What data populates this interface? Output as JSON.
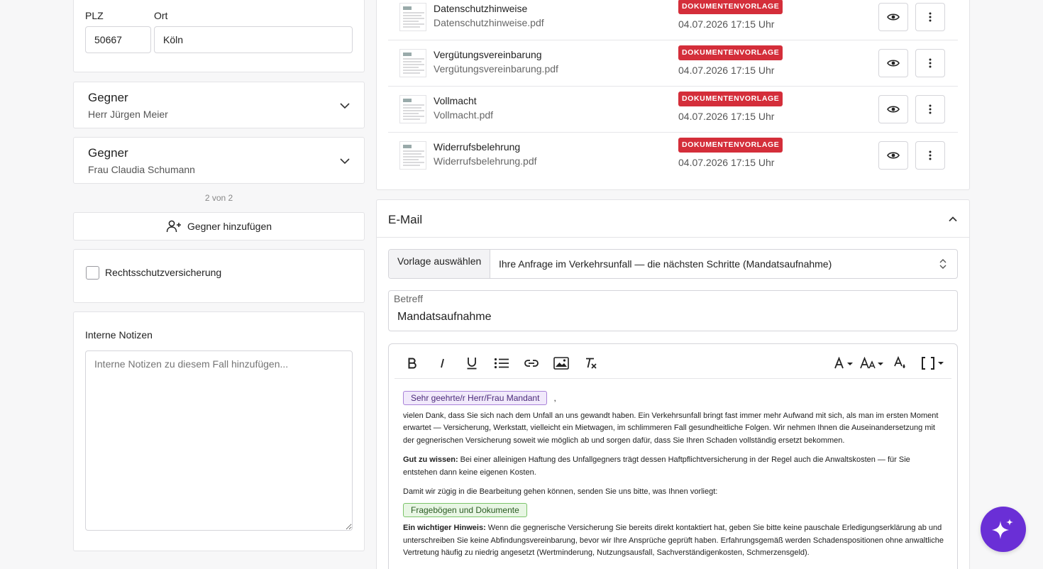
{
  "address": {
    "plz_label": "PLZ",
    "plz_value": "50667",
    "ort_label": "Ort",
    "ort_value": "Köln"
  },
  "opponents": [
    {
      "title": "Gegner",
      "name": "Herr Jürgen Meier"
    },
    {
      "title": "Gegner",
      "name": "Frau Claudia Schumann"
    }
  ],
  "pagination": "2 von 2",
  "add_opponent_label": "Gegner hinzufügen",
  "insurance_label": "Rechtsschutzversicherung",
  "notes": {
    "label": "Interne Notizen",
    "placeholder": "Interne Notizen zu diesem Fall hinzufügen..."
  },
  "documents": [
    {
      "name": "Datenschutzhinweise",
      "file": "Datenschutzhinweise.pdf",
      "badge": "DOKUMENTENVORLAGE",
      "date": "04.07.2026 17:15 Uhr"
    },
    {
      "name": "Vergütungsvereinbarung",
      "file": "Vergütungsvereinbarung.pdf",
      "badge": "DOKUMENTENVORLAGE",
      "date": "04.07.2026 17:15 Uhr"
    },
    {
      "name": "Vollmacht",
      "file": "Vollmacht.pdf",
      "badge": "DOKUMENTENVORLAGE",
      "date": "04.07.2026 17:15 Uhr"
    },
    {
      "name": "Widerrufsbelehrung",
      "file": "Widerrufsbelehrung.pdf",
      "badge": "DOKUMENTENVORLAGE",
      "date": "04.07.2026 17:15 Uhr"
    }
  ],
  "email": {
    "section_title": "E-Mail",
    "template_label": "Vorlage auswählen",
    "template_value": "Ihre Anfrage im Verkehrsunfall — die nächsten Schritte (Mandatsaufnahme)",
    "subject_label": "Betreff",
    "subject_value": "Mandatsaufnahme",
    "body": {
      "salutation_chip": "Sehr geehrte/r Herr/Frau Mandant",
      "salutation_suffix": ",",
      "p1": "vielen Dank, dass Sie sich nach dem Unfall an uns gewandt haben. Ein Verkehrsunfall bringt fast immer mehr Aufwand mit sich, als man im ersten Moment erwartet — Versicherung, Werkstatt, vielleicht ein Mietwagen, im schlimmeren Fall gesundheitliche Folgen. Wir nehmen Ihnen die Auseinandersetzung mit der gegnerischen Versicherung soweit wie möglich ab und sorgen dafür, dass Sie Ihren Schaden vollständig ersetzt bekommen.",
      "p2_bold": "Gut zu wissen:",
      "p2": " Bei einer alleinigen Haftung des Unfallgegners trägt dessen Haftpflichtversicherung in der Regel auch die Anwaltskosten — für Sie entstehen dann keine eigenen Kosten.",
      "p3": "Damit wir zügig in die Bearbeitung gehen können, senden Sie uns bitte, was Ihnen vorliegt:",
      "docs_chip": "Fragebögen und Dokumente",
      "p4_bold": "Ein wichtiger Hinweis:",
      "p4": " Wenn die gegnerische Versicherung Sie bereits direkt kontaktiert hat, geben Sie bitte keine pauschale Erledigungserklärung ab und unterschreiben Sie keine Abfindungsvereinbarung, bevor wir Ihre Ansprüche geprüft haben. Erfahrungsgemäß werden Schadenspositionen ohne anwaltliche Vertretung häufig zu niedrig angesetzt (Wertminderung, Nutzungsausfall, Sachverständigenkosten, Schmerzensgeld)."
    }
  },
  "colors": {
    "badge": "#d42e3a",
    "fab": "#6a2fd6",
    "salutation_chip_bg": "#f1e9fb",
    "docs_chip_bg": "#e8f6e4"
  },
  "icons": {
    "fab": "sparkle-icon",
    "view": "eye-icon",
    "more": "more-vertical-icon"
  }
}
